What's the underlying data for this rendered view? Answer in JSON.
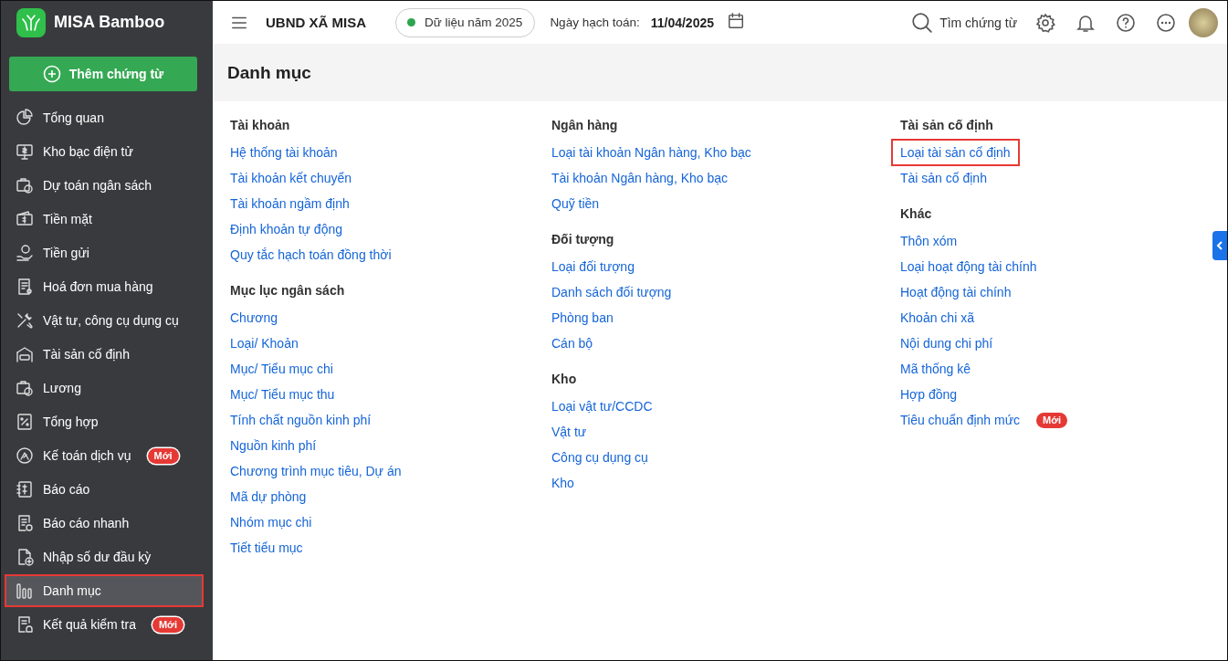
{
  "app": {
    "name": "MISA Bamboo",
    "add_button": "Thêm chứng từ"
  },
  "sidebar": {
    "items": [
      {
        "label": "Tổng quan",
        "selected": false,
        "highlighted": false
      },
      {
        "label": "Kho bạc điện tử",
        "selected": false,
        "highlighted": false
      },
      {
        "label": "Dự toán ngân sách",
        "selected": false,
        "highlighted": false
      },
      {
        "label": "Tiền mặt",
        "selected": false,
        "highlighted": false
      },
      {
        "label": "Tiền gửi",
        "selected": false,
        "highlighted": false
      },
      {
        "label": "Hoá đơn mua hàng",
        "selected": false,
        "highlighted": false
      },
      {
        "label": "Vật tư, công cụ dụng cụ",
        "selected": false,
        "highlighted": false
      },
      {
        "label": "Tài sản cố định",
        "selected": false,
        "highlighted": false
      },
      {
        "label": "Lương",
        "selected": false,
        "highlighted": false
      },
      {
        "label": "Tổng hợp",
        "selected": false,
        "highlighted": false
      },
      {
        "label": "Kế toán dịch vụ",
        "badge": "Mới",
        "selected": false,
        "highlighted": false
      },
      {
        "label": "Báo cáo",
        "selected": false,
        "highlighted": false
      },
      {
        "label": "Báo cáo nhanh",
        "selected": false,
        "highlighted": false
      },
      {
        "label": "Nhập số dư đầu kỳ",
        "selected": false,
        "highlighted": false
      },
      {
        "label": "Danh mục",
        "selected": true,
        "highlighted": true
      },
      {
        "label": "Kết quả kiểm tra",
        "badge": "Mới",
        "selected": false,
        "highlighted": false
      }
    ]
  },
  "header": {
    "organization": "UBND XÃ MISA",
    "data_year": "Dữ liệu năm 2025",
    "posting_date_label": "Ngày hạch toán:",
    "posting_date": "11/04/2025",
    "search": "Tìm chứng từ"
  },
  "page": {
    "title": "Danh mục",
    "columns": [
      {
        "groups": [
          {
            "title": "Tài khoản",
            "links": [
              {
                "label": "Hệ thống tài khoản",
                "highlighted": false
              },
              {
                "label": "Tài khoản kết chuyển",
                "highlighted": false
              },
              {
                "label": "Tài khoản ngầm định",
                "highlighted": false
              },
              {
                "label": "Định khoản tự động",
                "highlighted": false
              },
              {
                "label": "Quy tắc hạch toán đồng thời",
                "highlighted": false
              }
            ]
          },
          {
            "title": "Mục lục ngân sách",
            "links": [
              {
                "label": "Chương",
                "highlighted": false
              },
              {
                "label": "Loại/ Khoản",
                "highlighted": false
              },
              {
                "label": "Mục/ Tiểu mục chi",
                "highlighted": false
              },
              {
                "label": "Mục/ Tiểu mục thu",
                "highlighted": false
              },
              {
                "label": "Tính chất nguồn kinh phí",
                "highlighted": false
              },
              {
                "label": "Nguồn kinh phí",
                "highlighted": false
              },
              {
                "label": "Chương trình mục tiêu, Dự án",
                "highlighted": false
              },
              {
                "label": "Mã dự phòng",
                "highlighted": false
              },
              {
                "label": "Nhóm mục chi",
                "highlighted": false
              },
              {
                "label": "Tiết tiểu mục",
                "highlighted": false
              }
            ]
          }
        ]
      },
      {
        "groups": [
          {
            "title": "Ngân hàng",
            "links": [
              {
                "label": "Loại tài khoản Ngân hàng, Kho bạc",
                "highlighted": false
              },
              {
                "label": "Tài khoản Ngân hàng, Kho bạc",
                "highlighted": false
              },
              {
                "label": "Quỹ tiền",
                "highlighted": false
              }
            ]
          },
          {
            "title": "Đối tượng",
            "links": [
              {
                "label": "Loại đối tượng",
                "highlighted": false
              },
              {
                "label": "Danh sách đối tượng",
                "highlighted": false
              },
              {
                "label": "Phòng ban",
                "highlighted": false
              },
              {
                "label": "Cán bộ",
                "highlighted": false
              }
            ]
          },
          {
            "title": "Kho",
            "links": [
              {
                "label": "Loại vật tư/CCDC",
                "highlighted": false
              },
              {
                "label": "Vật tư",
                "highlighted": false
              },
              {
                "label": "Công cụ dụng cụ",
                "highlighted": false
              },
              {
                "label": "Kho",
                "highlighted": false
              }
            ]
          }
        ]
      },
      {
        "groups": [
          {
            "title": "Tài sản cố định",
            "links": [
              {
                "label": "Loại tài sản cố định",
                "highlighted": true
              },
              {
                "label": "Tài sản cố định",
                "highlighted": false
              }
            ]
          },
          {
            "title": "Khác",
            "links": [
              {
                "label": "Thôn xóm",
                "highlighted": false
              },
              {
                "label": "Loại hoạt động tài chính",
                "highlighted": false
              },
              {
                "label": "Hoạt động tài chính",
                "highlighted": false
              },
              {
                "label": "Khoản chi xã",
                "highlighted": false
              },
              {
                "label": "Nội dung chi phí",
                "highlighted": false
              },
              {
                "label": "Mã thống kê",
                "highlighted": false
              },
              {
                "label": "Hợp đồng",
                "highlighted": false
              },
              {
                "label": "Tiêu chuẩn định mức",
                "badge": "Mới",
                "highlighted": false
              }
            ]
          }
        ]
      }
    ]
  }
}
